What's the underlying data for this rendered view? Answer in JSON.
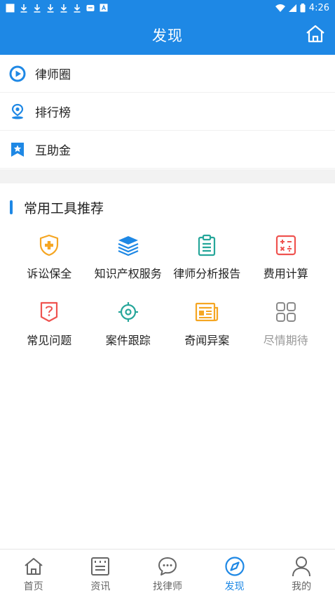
{
  "status_bar": {
    "time": "4:26",
    "icons": [
      "square-icon",
      "download-icon",
      "download-icon",
      "download-icon",
      "download-icon",
      "download-icon",
      "message-icon",
      "a-icon",
      "wifi-icon",
      "signal-icon",
      "battery-icon"
    ]
  },
  "header": {
    "title": "发现",
    "home_icon": "home-icon"
  },
  "menu": {
    "items": [
      {
        "label": "律师圈",
        "icon": "play-circle-icon"
      },
      {
        "label": "排行榜",
        "icon": "location-pin-icon"
      },
      {
        "label": "互助金",
        "icon": "star-bookmark-icon"
      }
    ]
  },
  "tools_section": {
    "title": "常用工具推荐",
    "items": [
      {
        "label": "诉讼保全",
        "icon": "shield-plus-icon",
        "color": "#f5a623"
      },
      {
        "label": "知识产权服务",
        "icon": "book-stack-icon",
        "color": "#1e88e5"
      },
      {
        "label": "律师分析报告",
        "icon": "clipboard-icon",
        "color": "#26a69a"
      },
      {
        "label": "费用计算",
        "icon": "calculator-icon",
        "color": "#ef5350"
      },
      {
        "label": "常见问题",
        "icon": "question-icon",
        "color": "#ef5350"
      },
      {
        "label": "案件跟踪",
        "icon": "target-icon",
        "color": "#26a69a"
      },
      {
        "label": "奇闻异案",
        "icon": "newspaper-icon",
        "color": "#f5a623"
      },
      {
        "label": "尽情期待",
        "icon": "grid-icon",
        "color": "#8a8a8a"
      }
    ]
  },
  "tabbar": {
    "tabs": [
      {
        "label": "首页",
        "icon": "home-icon"
      },
      {
        "label": "资讯",
        "icon": "news-icon"
      },
      {
        "label": "找律师",
        "icon": "chat-icon"
      },
      {
        "label": "发现",
        "icon": "compass-icon",
        "active": true
      },
      {
        "label": "我的",
        "icon": "user-icon"
      }
    ]
  },
  "colors": {
    "primary": "#1e88e5",
    "band": "#f2f2f2",
    "text": "#222222",
    "muted": "#999999"
  }
}
